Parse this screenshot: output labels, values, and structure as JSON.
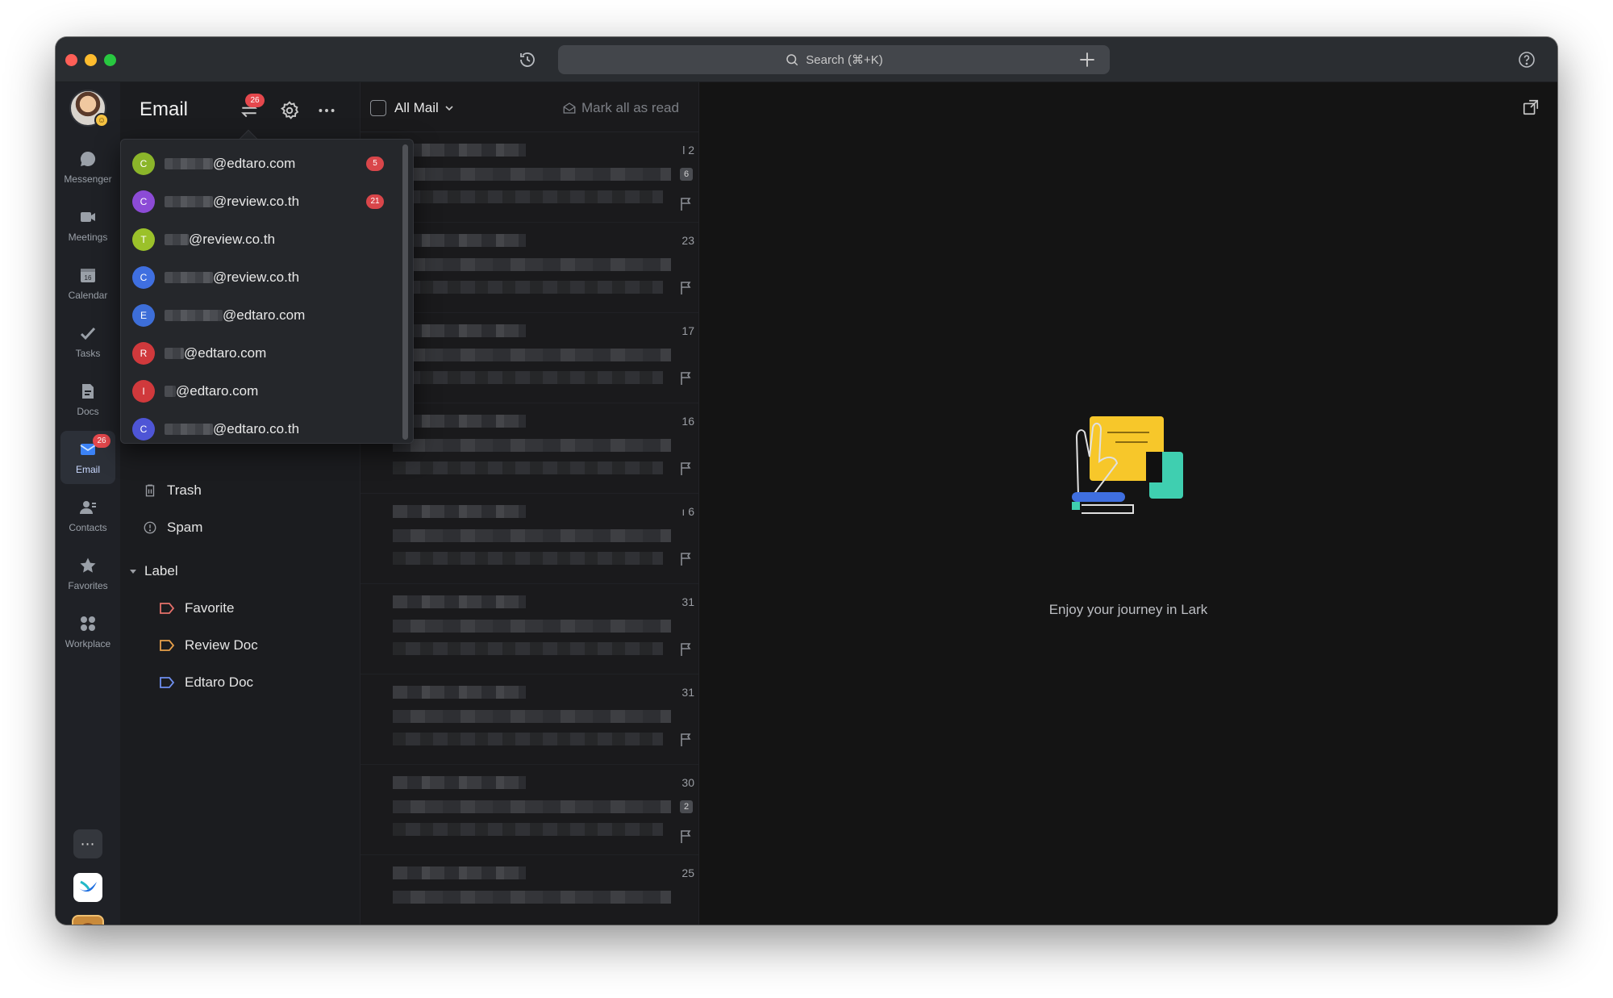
{
  "titlebar": {
    "search_placeholder": "Search (⌘+K)"
  },
  "rail": {
    "items": [
      {
        "label": "Messenger",
        "icon": "chat-bubble-icon"
      },
      {
        "label": "Meetings",
        "icon": "video-camera-icon"
      },
      {
        "label": "Calendar",
        "icon": "calendar-icon",
        "day": "16"
      },
      {
        "label": "Tasks",
        "icon": "checkmark-icon"
      },
      {
        "label": "Docs",
        "icon": "document-icon"
      },
      {
        "label": "Email",
        "icon": "envelope-icon",
        "badge": "26",
        "active": true
      },
      {
        "label": "Contacts",
        "icon": "person-icon"
      },
      {
        "label": "Favorites",
        "icon": "star-icon"
      },
      {
        "label": "Workplace",
        "icon": "apps-grid-icon"
      }
    ],
    "more_label": "⋯"
  },
  "sidebar": {
    "title": "Email",
    "switch_badge": "26",
    "folders": [
      {
        "label": "Trash",
        "icon": "trash-icon"
      },
      {
        "label": "Spam",
        "icon": "alert-circle-icon"
      }
    ],
    "label_section": "Label",
    "labels": [
      {
        "label": "Favorite",
        "color": "#e5706a"
      },
      {
        "label": "Review Doc",
        "color": "#e8a04a"
      },
      {
        "label": "Edtaro Doc",
        "color": "#6f8ff0"
      }
    ]
  },
  "accounts": [
    {
      "initial": "C",
      "color": "#8bb52a",
      "domain": "@edtaro.com",
      "count": "5"
    },
    {
      "initial": "C",
      "color": "#8c4bd6",
      "domain": "@review.co.th",
      "count": "21"
    },
    {
      "initial": "T",
      "color": "#9bc12a",
      "domain": "@review.co.th",
      "count": ""
    },
    {
      "initial": "C",
      "color": "#3f6fe0",
      "domain": "@review.co.th",
      "count": ""
    },
    {
      "initial": "E",
      "color": "#3d6ed8",
      "domain": "@edtaro.com",
      "count": ""
    },
    {
      "initial": "R",
      "color": "#d0393c",
      "domain": "@edtaro.com",
      "count": ""
    },
    {
      "initial": "I",
      "color": "#d0393c",
      "domain": "@edtaro.com",
      "count": ""
    },
    {
      "initial": "C",
      "color": "#4e55d6",
      "domain": "@edtaro.co.th",
      "count": ""
    }
  ],
  "mail_list": {
    "filter": "All Mail",
    "mark_all": "Mark all as read",
    "messages": [
      {
        "date": "l 2",
        "count": "6"
      },
      {
        "date": "23",
        "count": ""
      },
      {
        "date": "17",
        "count": ""
      },
      {
        "date": "16",
        "count": ""
      },
      {
        "date": "ı 6",
        "count": ""
      },
      {
        "date": "31",
        "count": ""
      },
      {
        "date": "31",
        "count": ""
      },
      {
        "date": "30",
        "count": "2"
      },
      {
        "date": "25",
        "count": ""
      }
    ]
  },
  "reading": {
    "empty_text": "Enjoy your journey in Lark"
  }
}
